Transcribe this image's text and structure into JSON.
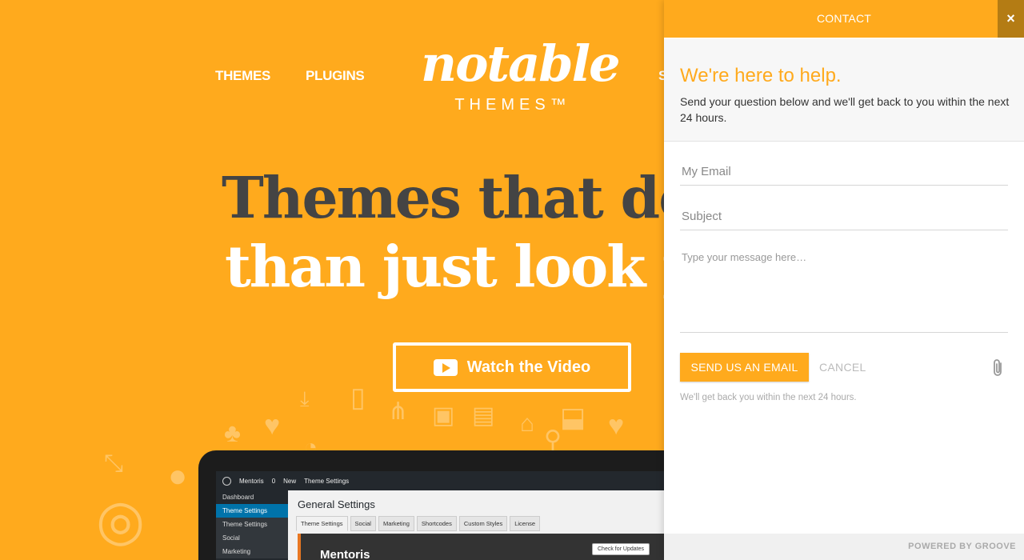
{
  "site": {
    "nav": {
      "themes": "THEMES",
      "plugins": "PLUGINS",
      "support_partial": "S"
    },
    "logo": {
      "script": "notable",
      "sub": "THEMES™"
    },
    "hero": {
      "line1": "Themes that do m",
      "line2": "than just look pr"
    },
    "cta": {
      "label": "Watch the Video",
      "icon": "youtube-play-icon"
    },
    "laptop": {
      "adminbar": {
        "site_name": "Mentoris",
        "comments": "0",
        "new": "New",
        "current": "Theme Settings"
      },
      "sidebar": [
        "Dashboard",
        "Theme Settings",
        "Theme Settings",
        "Social",
        "Marketing"
      ],
      "page_title": "General Settings",
      "tabs": [
        "Theme Settings",
        "Social",
        "Marketing",
        "Shortcodes",
        "Custom Styles",
        "License"
      ],
      "panel_title": "Mentoris",
      "check_button": "Check for Updates"
    }
  },
  "widget": {
    "header": "CONTACT",
    "close_icon": "×",
    "heading": "We're here to help.",
    "description": "Send your question below and we'll get back to you within the next 24 hours.",
    "email_placeholder": "My Email",
    "subject_placeholder": "Subject",
    "message_placeholder": "Type your message here…",
    "send_label": "SEND US AN EMAIL",
    "cancel_label": "CANCEL",
    "attach_icon": "paperclip-icon",
    "note": "We'll get back you within the next 24 hours.",
    "footer": "POWERED BY GROOVE"
  },
  "colors": {
    "accent": "#FFAA1D",
    "close_bg": "#b47c14",
    "hero_dark": "#444444"
  }
}
